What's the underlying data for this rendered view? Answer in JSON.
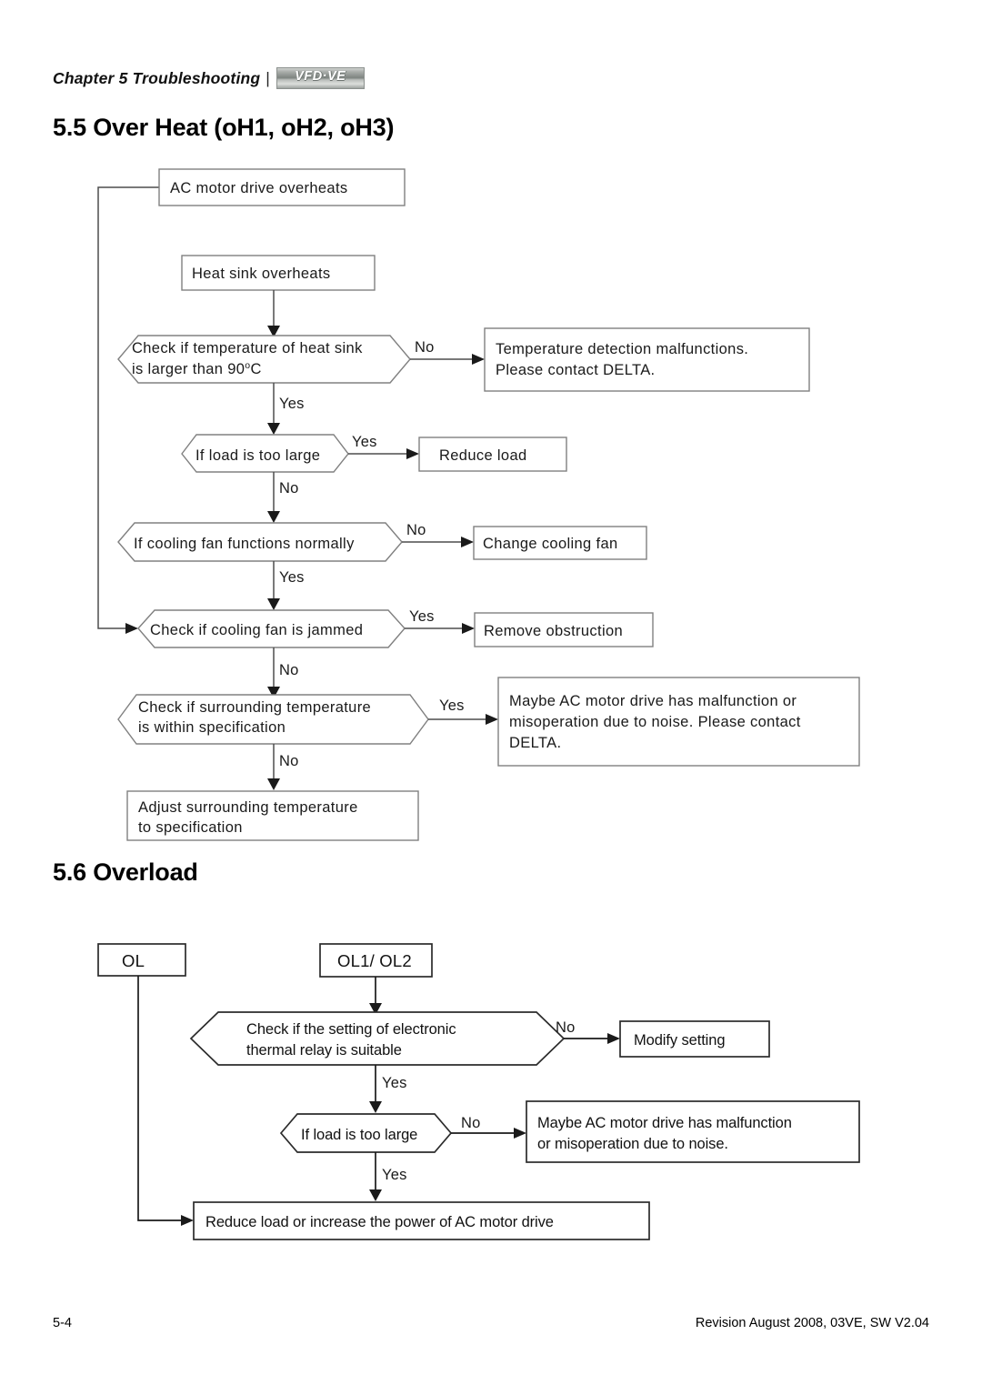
{
  "header": {
    "chapter": "Chapter 5  Troubleshooting",
    "separator": "|",
    "logo": "VFD·VE"
  },
  "sections": {
    "over_heat": {
      "heading": "5.5 Over Heat (oH1, oH2, oH3)"
    },
    "overload": {
      "heading": "5.6 Overload"
    }
  },
  "footer": {
    "page_number": "5-4",
    "revision": "Revision August 2008, 03VE, SW V2.04"
  },
  "chart_data": {
    "type": "diagram",
    "title": "Over Heat and Overload troubleshooting flowcharts",
    "flowcharts": [
      {
        "id": "over-heat",
        "title": "5.5 Over Heat (oH1, oH2, oH3)",
        "nodes": [
          {
            "id": "oh-start",
            "shape": "rect",
            "text": "AC motor drive overheats"
          },
          {
            "id": "oh-heatsink",
            "shape": "rect",
            "text": "Heat sink overheats"
          },
          {
            "id": "oh-temp-check",
            "shape": "hexagon",
            "text_line1": "Check if temperature of heat sink",
            "text_line2": "is larger than 90",
            "text_unit": "C",
            "text_degree": "o"
          },
          {
            "id": "oh-temp-fail",
            "shape": "rect",
            "text_line1": "Temperature detection malfunctions.",
            "text_line2": "Please contact DELTA."
          },
          {
            "id": "oh-load",
            "shape": "hexagon",
            "text": "If load is too large"
          },
          {
            "id": "oh-reduce-load",
            "shape": "rect",
            "text": "Reduce load"
          },
          {
            "id": "oh-fan-normal",
            "shape": "hexagon",
            "text": "If cooling fan functions normally"
          },
          {
            "id": "oh-change-fan",
            "shape": "rect",
            "text": "Change cooling fan"
          },
          {
            "id": "oh-fan-jammed",
            "shape": "hexagon",
            "text": "Check if cooling fan is jammed"
          },
          {
            "id": "oh-remove-obs",
            "shape": "rect",
            "text": "Remove obstruction"
          },
          {
            "id": "oh-surround",
            "shape": "hexagon",
            "text_line1": "Check if surrounding temperature",
            "text_line2": "is within specification"
          },
          {
            "id": "oh-noise",
            "shape": "rect",
            "text_line1": "Maybe AC motor drive has malfunction or",
            "text_line2": "misoperation due to noise. Please contact",
            "text_line3": "DELTA."
          },
          {
            "id": "oh-adjust",
            "shape": "rect",
            "text_line1": "Adjust surrounding temperature",
            "text_line2": "to specification"
          }
        ],
        "edges": [
          {
            "from": "oh-heatsink",
            "to": "oh-temp-check",
            "label": ""
          },
          {
            "from": "oh-temp-check",
            "to": "oh-temp-fail",
            "label": "No"
          },
          {
            "from": "oh-temp-check",
            "to": "oh-load",
            "label": "Yes"
          },
          {
            "from": "oh-load",
            "to": "oh-reduce-load",
            "label": "Yes"
          },
          {
            "from": "oh-load",
            "to": "oh-fan-normal",
            "label": "No"
          },
          {
            "from": "oh-fan-normal",
            "to": "oh-change-fan",
            "label": "No"
          },
          {
            "from": "oh-fan-normal",
            "to": "oh-fan-jammed",
            "label": "Yes"
          },
          {
            "from": "oh-fan-jammed",
            "to": "oh-remove-obs",
            "label": "Yes"
          },
          {
            "from": "oh-fan-jammed",
            "to": "oh-surround",
            "label": "No"
          },
          {
            "from": "oh-surround",
            "to": "oh-noise",
            "label": "Yes"
          },
          {
            "from": "oh-surround",
            "to": "oh-adjust",
            "label": "No"
          },
          {
            "from": "oh-start",
            "to": "oh-fan-jammed",
            "label": ""
          }
        ]
      },
      {
        "id": "overload",
        "title": "5.6 Overload",
        "nodes": [
          {
            "id": "ol-start",
            "shape": "rect",
            "text": "OL"
          },
          {
            "id": "ol12-start",
            "shape": "rect",
            "text": "OL1/ OL2"
          },
          {
            "id": "ol-relay",
            "shape": "hexagon",
            "text_line1": "Check if the setting of electronic",
            "text_line2": "thermal relay is suitable"
          },
          {
            "id": "ol-modify",
            "shape": "rect",
            "text": "Modify setting"
          },
          {
            "id": "ol-load",
            "shape": "hexagon",
            "text": "If load is too large"
          },
          {
            "id": "ol-noise",
            "shape": "rect",
            "text_line1": "Maybe AC motor drive has malfunction",
            "text_line2": "or misoperation due to noise."
          },
          {
            "id": "ol-reduce",
            "shape": "rect",
            "text": "Reduce load or increase the power of AC motor drive"
          }
        ],
        "edges": [
          {
            "from": "ol12-start",
            "to": "ol-relay",
            "label": ""
          },
          {
            "from": "ol-relay",
            "to": "ol-modify",
            "label": "No"
          },
          {
            "from": "ol-relay",
            "to": "ol-load",
            "label": "Yes"
          },
          {
            "from": "ol-load",
            "to": "ol-noise",
            "label": "No"
          },
          {
            "from": "ol-load",
            "to": "ol-reduce",
            "label": "Yes"
          },
          {
            "from": "ol-start",
            "to": "ol-reduce",
            "label": ""
          }
        ]
      }
    ],
    "labels": {
      "yes": "Yes",
      "no": "No"
    }
  }
}
